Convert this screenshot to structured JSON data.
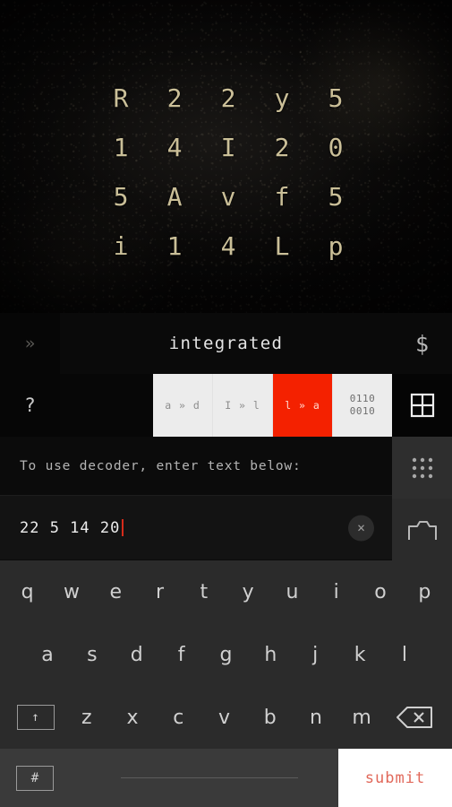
{
  "puzzle": {
    "grid_rows": [
      [
        "R",
        "2",
        "2",
        "y",
        "5"
      ],
      [
        "1",
        "4",
        "I",
        "2",
        "0"
      ],
      [
        "5",
        "A",
        "v",
        "f",
        "5"
      ],
      [
        "i",
        "1",
        "4",
        "L",
        "p"
      ]
    ]
  },
  "titlebar": {
    "menu_icon": "»",
    "title": "integrated",
    "currency_icon": "$"
  },
  "modebar": {
    "help_label": "?",
    "grid_icon": "four-pane-grid",
    "modes": [
      {
        "label": "a » d",
        "active": false
      },
      {
        "label": "I » l",
        "active": false
      },
      {
        "label": "l » a",
        "active": true
      },
      {
        "label": "0110\n0010",
        "active": false,
        "binary": true
      }
    ],
    "binary_line1": "0110",
    "binary_line2": "0010",
    "active_color": "#f42100"
  },
  "decoder": {
    "hint": "To use decoder, enter text below:",
    "input_value": "22 5 14 20",
    "input_placeholder": "",
    "clear_label": "×"
  },
  "sidebar": {
    "dots_icon": "nine-dots-grid",
    "camera_icon": "camera"
  },
  "keyboard": {
    "row1": [
      "q",
      "w",
      "e",
      "r",
      "t",
      "y",
      "u",
      "i",
      "o",
      "p"
    ],
    "row2": [
      "a",
      "s",
      "d",
      "f",
      "g",
      "h",
      "j",
      "k",
      "l"
    ],
    "row3": [
      "z",
      "x",
      "c",
      "v",
      "b",
      "n",
      "m"
    ],
    "shift_label": "↑",
    "backspace_label": "backspace",
    "numeric_label": "#",
    "space_label": "",
    "submit_label": "submit",
    "submit_color": "#e1685a"
  }
}
